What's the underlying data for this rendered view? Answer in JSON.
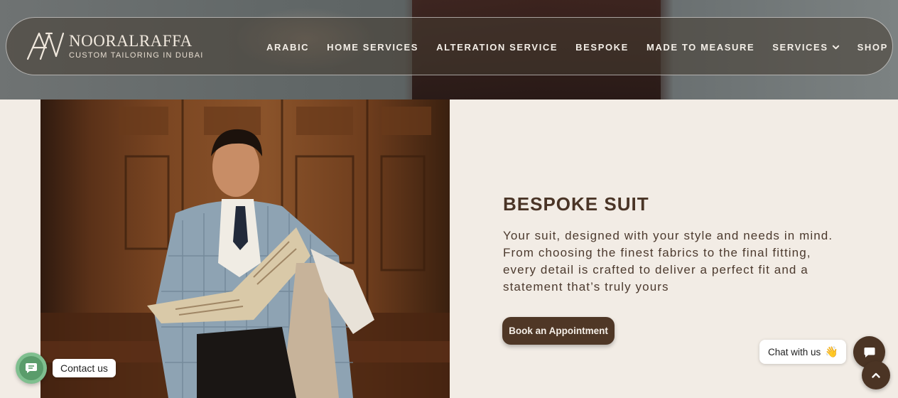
{
  "brand": {
    "name": "NOORALRAFFA",
    "tagline": "CUSTOM TAILORING IN DUBAI"
  },
  "nav": {
    "items": [
      "ARABIC",
      "HOME SERVICES",
      "ALTERATION SERVICE",
      "BESPOKE",
      "MADE TO MEASURE",
      "SERVICES",
      "SHOP"
    ]
  },
  "section": {
    "title": "BESPOKE SUIT",
    "description": "Your suit, designed with your style and needs in mind. From choosing the finest fabrics to the final fitting, every detail is crafted to deliver a perfect fit and a statement that’s truly yours",
    "cta_label": "Book an Appointment"
  },
  "widgets": {
    "contact_label": "Contact us",
    "chat_label": "Chat with us",
    "chat_emoji": "👋"
  },
  "colors": {
    "accent": "#4f3726",
    "background": "#f2ece5",
    "contact_green": "#7fbf8f"
  },
  "icons": {
    "chevron": "chevron-down-icon",
    "contact": "chat-bubble-icon",
    "chat": "message-square-icon",
    "scroll_top": "chevron-up-icon"
  }
}
